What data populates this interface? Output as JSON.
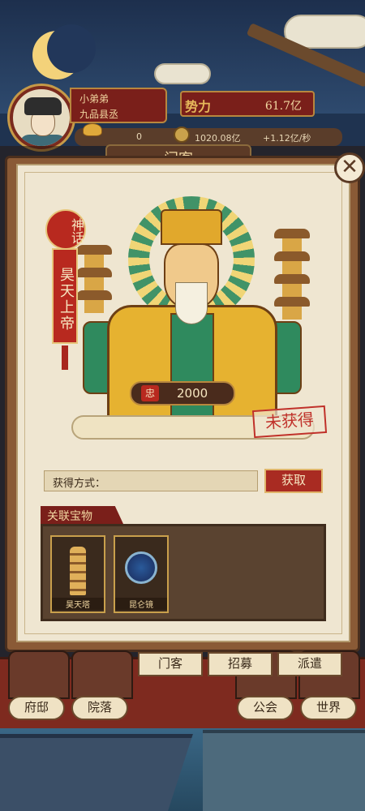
{
  "player": {
    "name": "小弟弟",
    "rank": "九品县丞",
    "power_label": "势力",
    "power_value": "61.7亿"
  },
  "resources": {
    "ingots": "0",
    "silver": "1020.08亿",
    "silver_rate": "+1.12亿/秒"
  },
  "modal": {
    "header": "门客",
    "close_icon": "close-icon"
  },
  "hero": {
    "category": "神话",
    "name": "昊天上帝",
    "loyalty_badge": "忠",
    "loyalty_value": "2000",
    "status": "未获得"
  },
  "acquire": {
    "label": "获得方式：",
    "button": "获取"
  },
  "treasures": {
    "title": "关联宝物",
    "items": [
      {
        "name": "昊天塔",
        "icon": "tower-icon"
      },
      {
        "name": "昆仑镜",
        "icon": "mirror-icon"
      }
    ]
  },
  "nav": {
    "tabs": [
      "门客",
      "招募",
      "派遣"
    ],
    "left": [
      "府邸",
      "院落"
    ],
    "right": [
      "公会",
      "世界"
    ]
  },
  "colors": {
    "accent_red": "#a92b22",
    "gold": "#e6b230",
    "jade": "#2f8a5e",
    "paper": "#efe6d1"
  }
}
